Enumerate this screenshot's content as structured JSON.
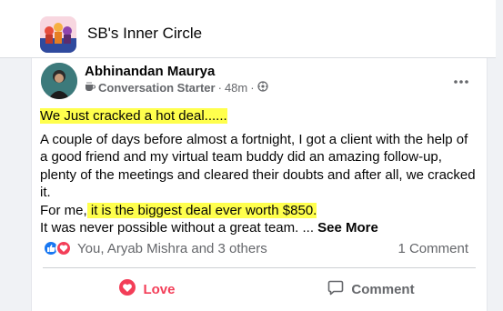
{
  "group": {
    "name": "SB's Inner Circle"
  },
  "post": {
    "author": "Abhinandan Maurya",
    "badge": "Conversation Starter",
    "time": "48m",
    "separator": "·",
    "headline": "We Just cracked a hot deal......",
    "body_line1": "A couple of days before almost a fortnight, I got a client with the help of a good friend and my virtual team buddy did an amazing follow-up, plenty of the meetings and cleared their doubts and after all, we cracked it.",
    "body_line2_prefix": "For me,",
    "body_line2_highlight": " it is the biggest deal ever worth $850.",
    "body_line3": "It was never possible without a great team. ... ",
    "see_more": "See More",
    "reactors": "You, Aryab Mishra and 3 others",
    "comment_count": "1 Comment"
  },
  "actions": {
    "love_label": "Love",
    "comment_label": "Comment"
  },
  "icons": {
    "more": "more-horizontal-icon",
    "badge": "coffee-cup-icon",
    "privacy": "globe-icon",
    "like": "thumbs-up-icon",
    "love": "heart-icon",
    "comment": "comment-bubble-icon"
  },
  "colors": {
    "highlight": "#ffff4d",
    "love": "#f33e58",
    "like": "#1877f2",
    "secondary_text": "#65676b"
  }
}
